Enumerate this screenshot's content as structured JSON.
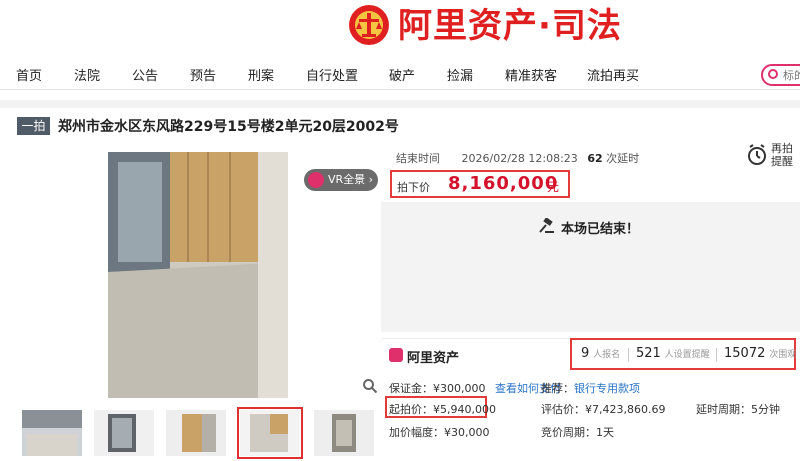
{
  "header": {
    "logo_text": "阿里资产·司法",
    "logo_color": "#e02020"
  },
  "nav": {
    "items": [
      "首页",
      "法院",
      "公告",
      "预告",
      "刑案",
      "自行处置",
      "破产",
      "捡漏",
      "精准获客",
      "流拍再买"
    ],
    "search_placeholder": "标的"
  },
  "listing": {
    "tag": "一拍",
    "title": "郑州市金水区东风路229号15号楼2单元20层2002号",
    "vr_label": "VR全景 ›"
  },
  "auction": {
    "end_label": "结束时间",
    "end_time": "2026/02/28 12:08:23",
    "delay_count": "62",
    "delay_label": "次延时",
    "remind_label": "再拍提醒",
    "price_label": "拍下价",
    "price_value": "8,160,000",
    "price_unit": "元",
    "price_color": "#d4122b",
    "ended_text": "本场已结束！"
  },
  "brand": {
    "name": "阿里资产"
  },
  "stats": {
    "signups": "9",
    "signups_label": "人报名",
    "reminders": "521",
    "reminders_label": "人设置提醒",
    "views": "15072",
    "views_label": "次围观"
  },
  "details": {
    "deposit_label": "保证金：",
    "deposit_value": "¥300,000",
    "deposit_link": "查看如何支付",
    "recommend_label": "推荐：",
    "recommend_link": "银行专用款项",
    "start_label": "起拍价：",
    "start_value": "¥5,940,000",
    "appraisal_label": "评估价：",
    "appraisal_value": "¥7,423,860.69",
    "delay_period_label": "延时周期：",
    "delay_period_value": "5分钟",
    "increment_label": "加价幅度：",
    "increment_value": "¥30,000",
    "cycle_label": "竞价周期：",
    "cycle_value": "1天"
  }
}
